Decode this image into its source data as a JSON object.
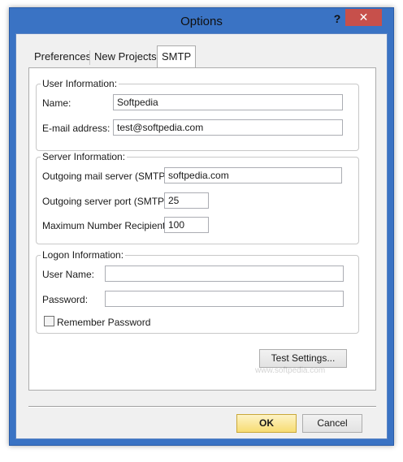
{
  "window": {
    "title": "Options",
    "help_label": "?",
    "close_label": "✕"
  },
  "tabs": [
    {
      "label": "Preferences",
      "active": false
    },
    {
      "label": "New Projects",
      "active": false
    },
    {
      "label": "SMTP",
      "active": true
    }
  ],
  "user_info": {
    "legend": "User Information:",
    "name_label": "Name:",
    "name_value": "Softpedia",
    "email_label": "E-mail address:",
    "email_value": "test@softpedia.com"
  },
  "server_info": {
    "legend": "Server Information:",
    "mail_server_label": "Outgoing mail server (SMTP):",
    "mail_server_value": "softpedia.com",
    "port_label": "Outgoing server port (SMTP):",
    "port_value": "25",
    "max_recipients_label": "Maximum Number Recipients:",
    "max_recipients_value": "100"
  },
  "logon_info": {
    "legend": "Logon Information:",
    "username_label": "User Name:",
    "username_value": "",
    "password_label": "Password:",
    "password_value": "",
    "remember_label": "Remember Password",
    "remember_checked": false
  },
  "buttons": {
    "test_settings": "Test Settings...",
    "ok": "OK",
    "cancel": "Cancel"
  },
  "watermark": {
    "brand": "SOFTPEDIA",
    "url": "www.softpedia.com"
  },
  "colors": {
    "frame": "#3a73c4",
    "close": "#c7504b",
    "ok_button": "#f7dc72"
  }
}
